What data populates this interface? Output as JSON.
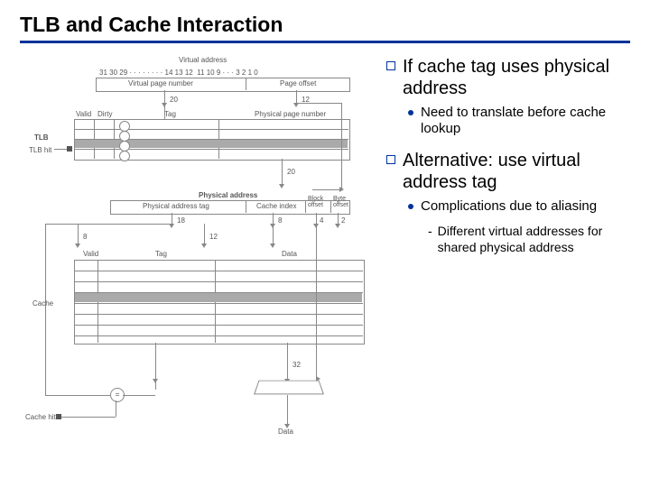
{
  "title": "TLB and Cache Interaction",
  "bullets": {
    "p1": "If cache tag uses physical address",
    "p1_sub1": "Need to translate before cache lookup",
    "p2": "Alternative: use virtual address tag",
    "p2_sub1": "Complications due to aliasing",
    "p2_sub1_sub1": "Different virtual addresses for shared physical address"
  },
  "diag": {
    "va_title": "Virtual address",
    "bits": {
      "b31": "31",
      "b30": "30",
      "b29": "29",
      "dots": "· · · · · · · ·",
      "b14": "14",
      "b13": "13",
      "b12": "12",
      "b11": "11",
      "b10": "10",
      "b9": "9",
      "dots2": "· · ·",
      "b3": "3",
      "b2": "2",
      "b1": "1",
      "b0": "0"
    },
    "vpn": "Virtual page number",
    "po": "Page offset",
    "w20a": "20",
    "w12": "12",
    "valid": "Valid",
    "dirty": "Dirty",
    "tag": "Tag",
    "ppn": "Physical page number",
    "tlb": "TLB",
    "tlb_hit": "TLB hit",
    "w20b": "20",
    "pa_title": "Physical address",
    "pat": "Physical address tag",
    "ci": "Cache index",
    "bo": "Block\noffset",
    "byo": "Byte\noffset",
    "w18": "18",
    "w8": "8",
    "w4": "4",
    "w2": "2",
    "w8b": "8",
    "w12b": "12",
    "valid2": "Valid",
    "tag2": "Tag",
    "data": "Data",
    "cache": "Cache",
    "cache_hit": "Cache hit",
    "w32": "32",
    "data_out": "Data"
  }
}
